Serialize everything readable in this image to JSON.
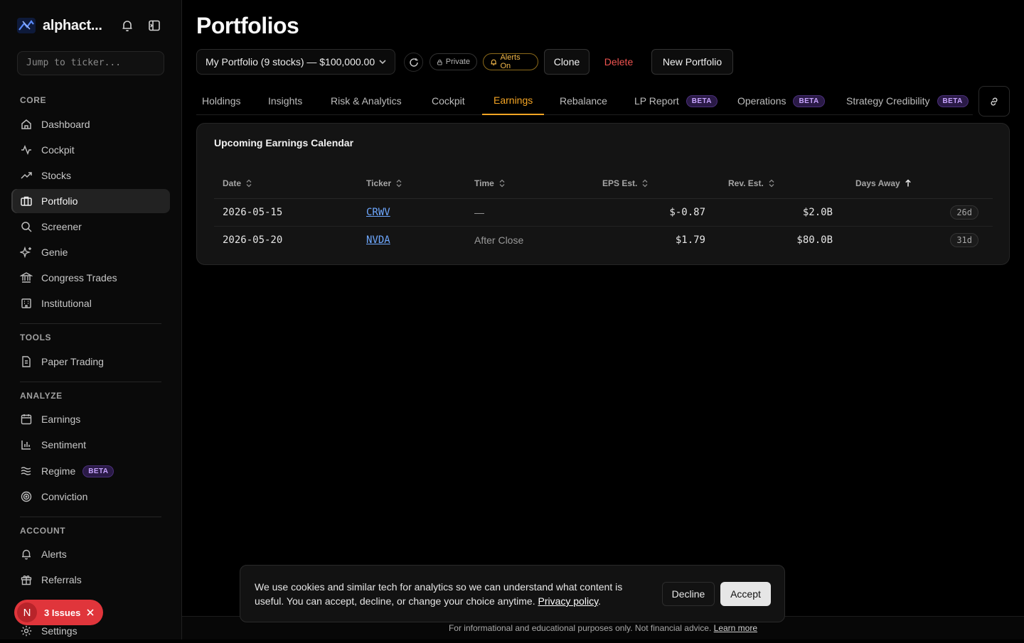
{
  "app": {
    "brand": "alphact..."
  },
  "sidebar": {
    "search_placeholder": "Jump to ticker...",
    "sections": {
      "core": "CORE",
      "tools": "TOOLS",
      "analyze": "ANALYZE",
      "account": "ACCOUNT"
    },
    "items": {
      "dashboard": "Dashboard",
      "cockpit": "Cockpit",
      "stocks": "Stocks",
      "portfolio": "Portfolio",
      "screener": "Screener",
      "genie": "Genie",
      "congress": "Congress Trades",
      "institutional": "Institutional",
      "paper": "Paper Trading",
      "earnings": "Earnings",
      "sentiment": "Sentiment",
      "regime": "Regime",
      "conviction": "Conviction",
      "alerts": "Alerts",
      "referrals": "Referrals",
      "settings": "Settings"
    },
    "beta": "BETA",
    "issues": {
      "avatar": "N",
      "label": "3 Issues"
    }
  },
  "header": {
    "title": "Portfolios",
    "portfolio_select": "My Portfolio (9 stocks) — $100,000.00",
    "private": "Private",
    "alerts_on": "Alerts On",
    "clone": "Clone",
    "delete": "Delete",
    "new_portfolio": "New Portfolio"
  },
  "tabs": {
    "holdings": "Holdings",
    "insights": "Insights",
    "risk": "Risk & Analytics",
    "cockpit": "Cockpit",
    "earnings": "Earnings",
    "rebalance": "Rebalance",
    "lp": "LP Report",
    "operations": "Operations",
    "strategy": "Strategy Credibility",
    "beta": "BETA"
  },
  "earnings_card": {
    "title": "Upcoming Earnings Calendar",
    "columns": {
      "date": "Date",
      "ticker": "Ticker",
      "time": "Time",
      "eps": "EPS Est.",
      "rev": "Rev. Est.",
      "days": "Days Away"
    },
    "rows": [
      {
        "date": "2026-05-15",
        "ticker": "CRWV",
        "time": "—",
        "eps": "$-0.87",
        "rev": "$2.0B",
        "days": "26d"
      },
      {
        "date": "2026-05-20",
        "ticker": "NVDA",
        "time": "After Close",
        "eps": "$1.79",
        "rev": "$80.0B",
        "days": "31d"
      }
    ]
  },
  "cookie": {
    "message": "We use cookies and similar tech for analytics so we can understand what content is useful. You can accept, decline, or change your choice anytime.",
    "policy_link": "Privacy policy",
    "decline": "Decline",
    "accept": "Accept"
  },
  "footer": {
    "text": "For informational and educational purposes only. Not financial advice.",
    "link": "Learn more"
  },
  "colors": {
    "accent": "#f5a524",
    "danger": "#ef5350",
    "link": "#6ea8ff",
    "beta": "#c8a4ff"
  }
}
